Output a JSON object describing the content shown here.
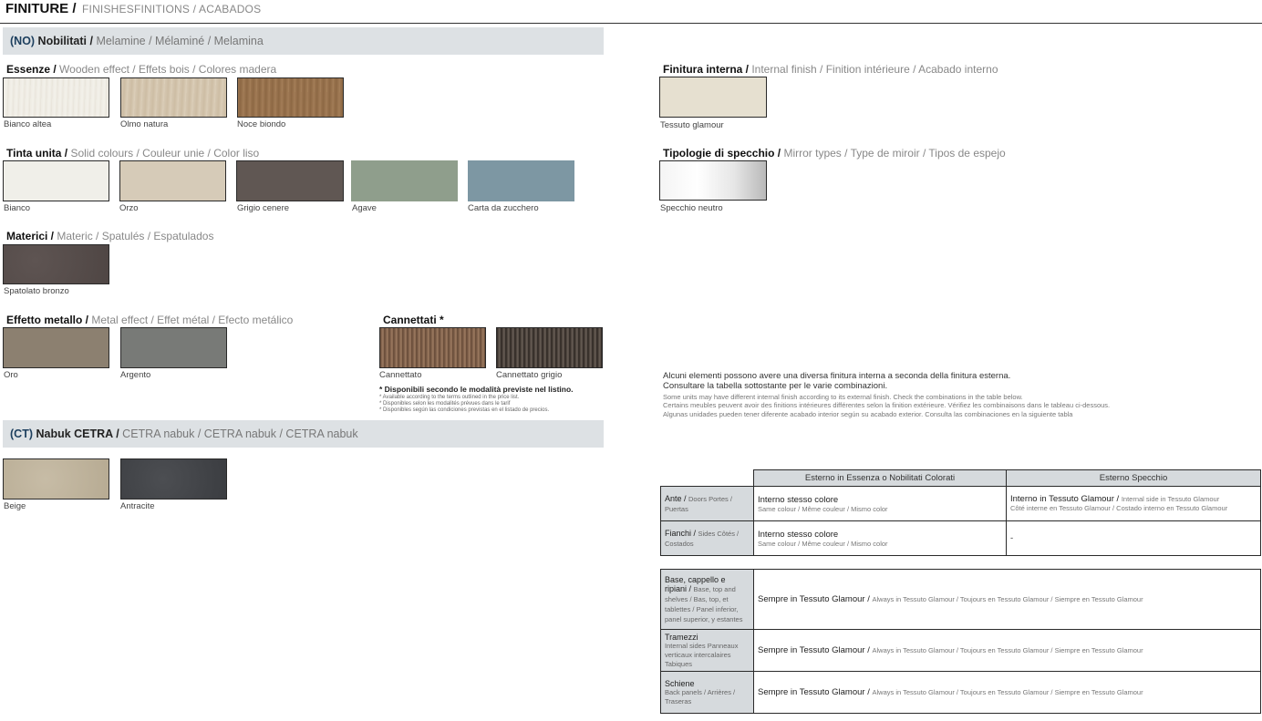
{
  "header": {
    "title": "FINITURE /",
    "langs": "FINISHESFINITIONS / ACABADOS"
  },
  "nobilitati": {
    "code": "(NO)",
    "title": " Nobilitati / ",
    "langs": "Melamine / Mélaminé / Melamina"
  },
  "essenze": {
    "title": "Essenze / ",
    "langs": "Wooden effect / Effets bois / Colores madera",
    "items": [
      "Bianco altea",
      "Olmo natura",
      "Noce biondo"
    ]
  },
  "tinta": {
    "title": "Tinta unita / ",
    "langs": "Solid colours / Couleur unie / Color liso",
    "items": [
      "Bianco",
      "Orzo",
      "Grigio cenere",
      "Agave",
      "Carta da zucchero"
    ]
  },
  "materici": {
    "title": "Materici / ",
    "langs": "Materic / Spatulés / Espatulados",
    "items": [
      "Spatolato bronzo"
    ]
  },
  "metallo": {
    "title": "Effetto metallo / ",
    "langs": "Metal effect / Effet métal / Efecto metálico",
    "items": [
      "Oro",
      "Argento"
    ]
  },
  "cannettati": {
    "title": "Cannettati *",
    "items": [
      "Cannettato",
      "Cannettato grigio"
    ],
    "note_bold": "* Disponibili secondo le modalità previste nel listino.",
    "notes": [
      "* Available according to the terms outlined in the price list.",
      "* Disponibles selon les modalités prévues dans le tarif",
      "* Disponibles según las condiciones previstas en el listado de precios."
    ]
  },
  "nabuk": {
    "code": "(CT)",
    "title": " Nabuk CETRA / ",
    "langs": "CETRA nabuk / CETRA nabuk / CETRA nabuk",
    "items": [
      "Beige",
      "Antracite"
    ]
  },
  "interna": {
    "title": "Finitura interna / ",
    "langs": "Internal finish / Finition intérieure / Acabado interno",
    "items": [
      "Tessuto glamour"
    ]
  },
  "specchio": {
    "title": "Tipologie di specchio / ",
    "langs": "Mirror types / Type de miroir / Tipos de espejo",
    "items": [
      "Specchio neutro"
    ]
  },
  "info": {
    "line1": "Alcuni elementi possono avere una diversa finitura interna a seconda della finitura esterna.",
    "line2": "Consultare la tabella sottostante per le varie combinazioni.",
    "line3": "Some units may have different internal finish according to its external finish. Check the combinations in the table below.",
    "line4": "Certains meubles peuvent avoir des finitions intérieures différentes selon la finition extérieure. Vérifiez les combinaisons dans le tableau ci-dessous.",
    "line5": "Algunas unidades pueden tener diferente acabado interior según su acabado exterior. Consulta las combinaciones en la siguiente tabla"
  },
  "table1": {
    "col1": "Esterno in Essenza o Nobilitati Colorati",
    "col2": "Esterno Specchio",
    "r1_head": "Ante / ",
    "r1_sub": "Doors Portes / Puertas",
    "r1_c1_main": "Interno stesso colore",
    "r1_c1_sub": "Same colour / Même couleur / Mismo color",
    "r1_c2_main": "Interno in Tessuto Glamour / ",
    "r1_c2_sub": "Internal side in Tessuto Glamour",
    "r1_c2_sub2": "Côté interne en Tessuto Glamour / Costado interno en Tessuto Glamour",
    "r2_head": "Fianchi / ",
    "r2_sub": "Sides Côtés / Costados",
    "r2_c1_main": "Interno stesso colore",
    "r2_c1_sub": "Same colour / Même couleur / Mismo color",
    "r2_c2": "-"
  },
  "table2": {
    "r1_head": "Base, cappello e ripiani / ",
    "r1_sub": "Base, top and shelves / Bas, top, et tablettes / Panel inferior, panel superior, y estantes",
    "r2_head": "Tramezzi",
    "r2_sub": "Internal sides Panneaux verticaux intercalaires Tabiques",
    "r3_head": "Schiene",
    "r3_sub": "Back panels / Arrières / Traseras",
    "cell_main": "Sempre in Tessuto Glamour / ",
    "cell_sub": "Always in Tessuto Glamour / Toujours en Tessuto Glamour / Siempre en Tessuto Glamour"
  }
}
